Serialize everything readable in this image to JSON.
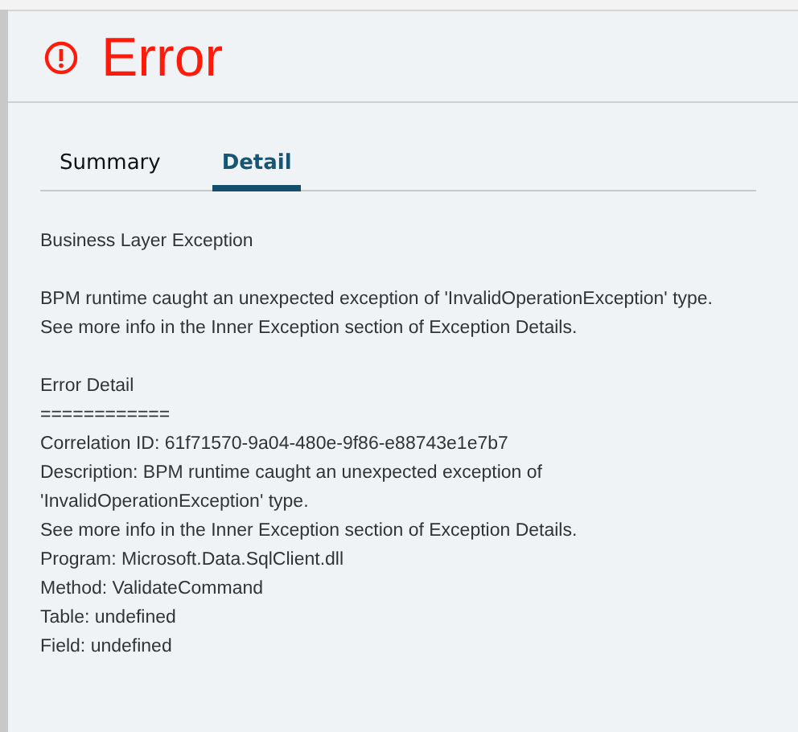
{
  "dialog": {
    "title": "Error"
  },
  "tabs": [
    {
      "label": "Summary",
      "selected": false
    },
    {
      "label": "Detail",
      "selected": true
    }
  ],
  "detail": {
    "paragraphs": [
      [
        "Business Layer Exception"
      ],
      [
        "BPM runtime caught an unexpected exception of 'InvalidOperationException' type.",
        "See more info in the Inner Exception section of Exception Details."
      ],
      [
        "Error Detail",
        "============",
        "Correlation ID: 61f71570-9a04-480e-9f86-e88743e1e7b7",
        "Description: BPM runtime caught an unexpected exception of 'InvalidOperationException' type.",
        "See more info in the Inner Exception section of Exception Details.",
        "Program: Microsoft.Data.SqlClient.dll",
        "Method: ValidateCommand",
        "Table: undefined",
        "Field: undefined"
      ]
    ]
  }
}
